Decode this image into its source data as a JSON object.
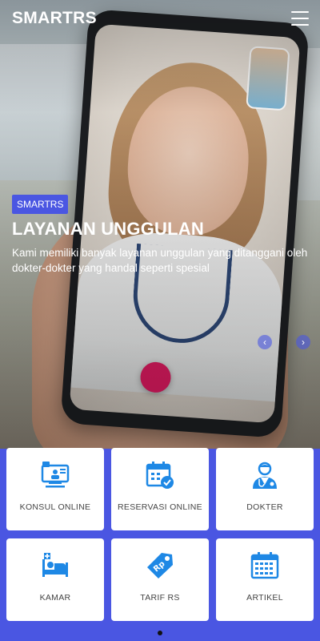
{
  "header": {
    "brand": "SMARTRS",
    "menu_icon": "hamburger-menu-icon"
  },
  "hero": {
    "badge": "SMARTRS",
    "title": "LAYANAN UNGGULAN",
    "description": "Kami memiliki banyak layanan unggulan yang ditanggani oleh dokter-dokter yang handal seperti spesial",
    "prev_icon": "chevron-left-icon",
    "next_icon": "chevron-right-icon"
  },
  "services": [
    {
      "label": "KONSUL ONLINE",
      "icon": "online-consultation-icon"
    },
    {
      "label": "RESERVASI ONLINE",
      "icon": "calendar-check-icon"
    },
    {
      "label": "DOKTER",
      "icon": "doctor-icon"
    },
    {
      "label": "KAMAR",
      "icon": "hospital-bed-icon"
    },
    {
      "label": "TARIF RS",
      "icon": "price-tag-icon"
    },
    {
      "label": "ARTIKEL",
      "icon": "calendar-grid-icon"
    }
  ],
  "colors": {
    "accent": "#4a56e2",
    "icon_blue": "#1e88e5"
  }
}
